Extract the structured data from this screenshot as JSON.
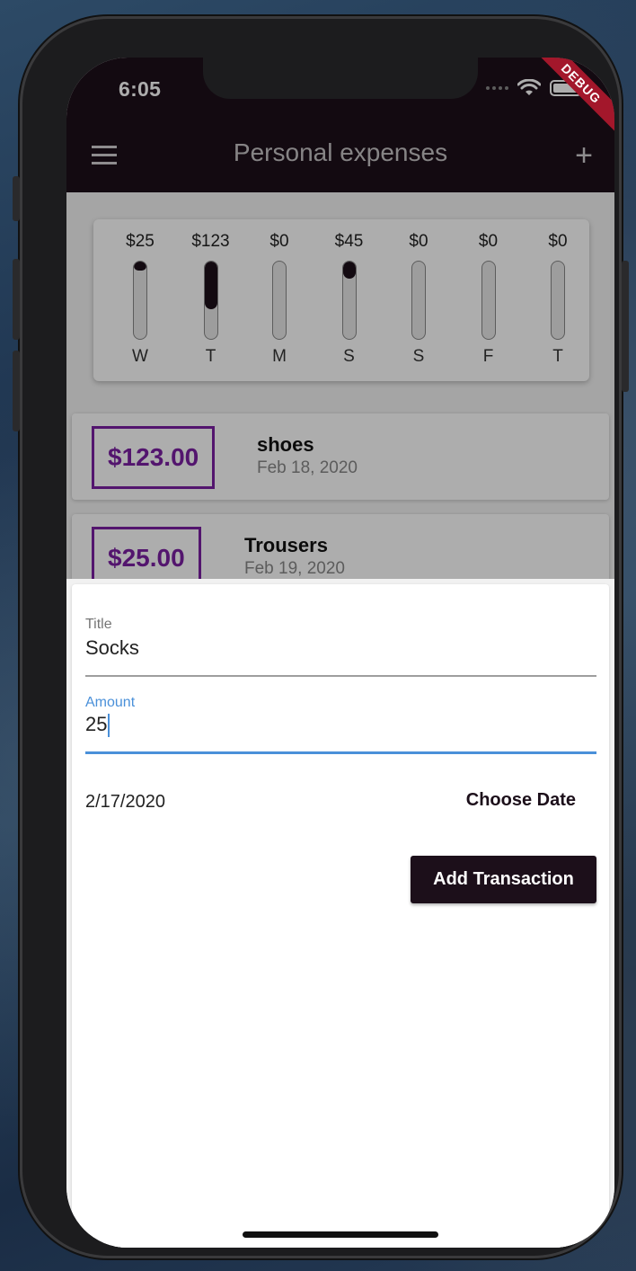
{
  "status_bar": {
    "time": "6:05",
    "debug_label": "DEBUG"
  },
  "app_bar": {
    "title": "Personal expenses",
    "menu_icon": "menu-icon",
    "add_icon": "add-icon"
  },
  "chart": {
    "bars": [
      {
        "amount": "$25",
        "day": "W",
        "fill_fraction": 0.12
      },
      {
        "amount": "$123",
        "day": "T",
        "fill_fraction": 0.62
      },
      {
        "amount": "$0",
        "day": "M",
        "fill_fraction": 0.0
      },
      {
        "amount": "$45",
        "day": "S",
        "fill_fraction": 0.22
      },
      {
        "amount": "$0",
        "day": "S",
        "fill_fraction": 0.0
      },
      {
        "amount": "$0",
        "day": "F",
        "fill_fraction": 0.0
      },
      {
        "amount": "$0",
        "day": "T",
        "fill_fraction": 0.0
      }
    ],
    "bar_color": "#1c0f1a"
  },
  "transactions": [
    {
      "amount": "$123.00",
      "title": "shoes",
      "date": "Feb 18, 2020"
    },
    {
      "amount": "$25.00",
      "title": "Trousers",
      "date": "Feb 19, 2020"
    }
  ],
  "form": {
    "title_label": "Title",
    "title_value": "Socks",
    "amount_label": "Amount",
    "amount_value": "25",
    "date_value": "2/17/2020",
    "choose_date_label": "Choose Date",
    "submit_label": "Add Transaction"
  },
  "colors": {
    "primary": "#1c0f1a",
    "accent": "#7b1fa2",
    "focus": "#4a90d9",
    "debug": "#a3172b"
  }
}
